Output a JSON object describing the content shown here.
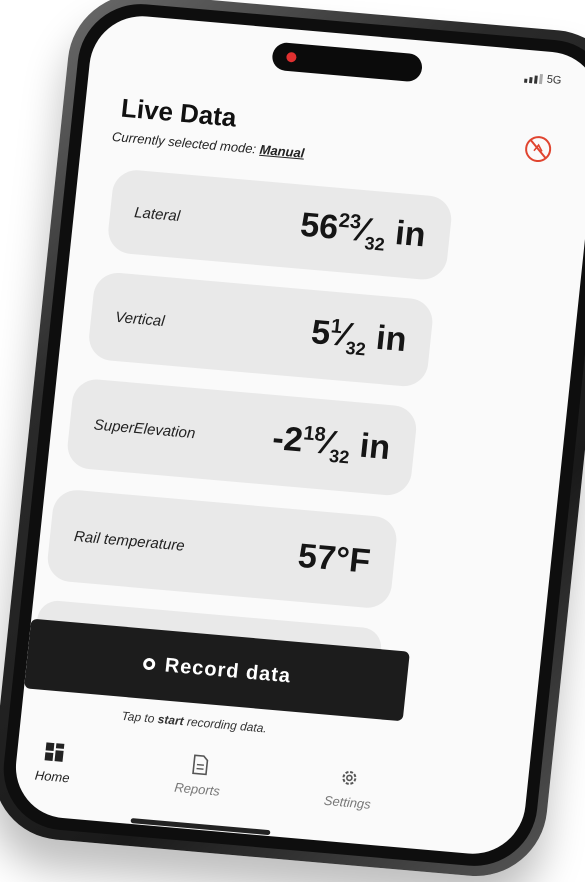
{
  "status": {
    "network": "5G"
  },
  "header": {
    "title": "Live Data",
    "mode_prefix": "Currently selected mode:",
    "mode_value": "Manual"
  },
  "cards": [
    {
      "label": "Lateral",
      "whole": "56",
      "num": "23",
      "den": "32",
      "unit": "in"
    },
    {
      "label": "Vertical",
      "whole": "5",
      "num": "1",
      "den": "32",
      "unit": "in"
    },
    {
      "label": "SuperElevation",
      "whole": "-2",
      "num": "18",
      "den": "32",
      "unit": "in"
    },
    {
      "label": "Rail temperature",
      "value": "57°F"
    }
  ],
  "record": {
    "label": "Record data"
  },
  "hint": {
    "pre": "Tap to",
    "strong": "start",
    "post": "recording data."
  },
  "tabs": [
    {
      "label": "Home",
      "icon": "grid-icon"
    },
    {
      "label": "Reports",
      "icon": "document-icon"
    },
    {
      "label": "Settings",
      "icon": "gear-icon"
    }
  ],
  "colors": {
    "accent": "#e0442f",
    "button_bg": "#1c1c1c",
    "card_bg": "#e9e9e9"
  }
}
